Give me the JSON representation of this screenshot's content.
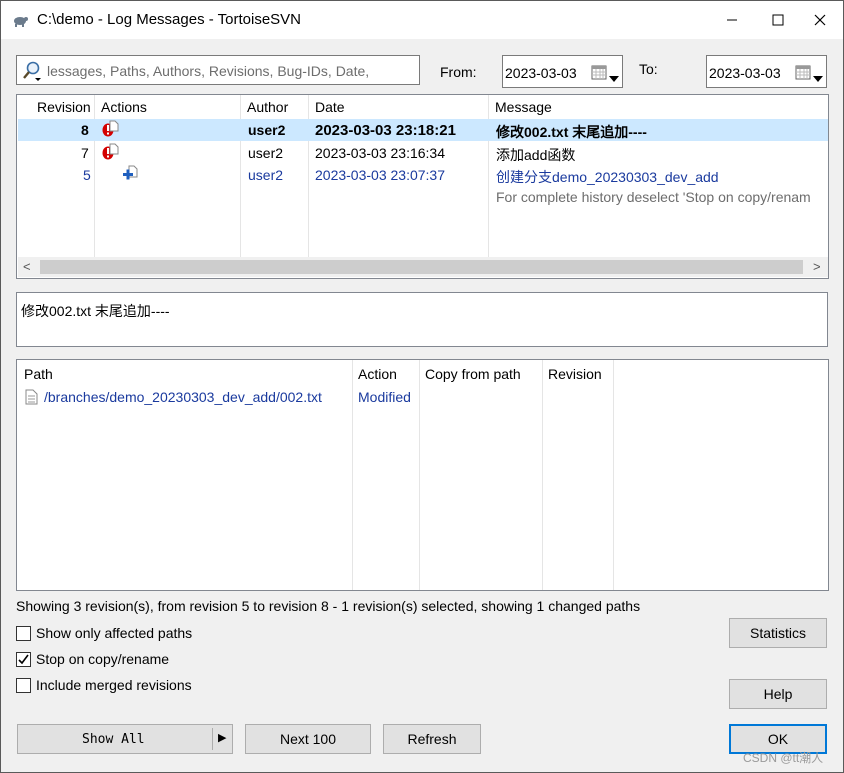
{
  "window": {
    "title": "C:\\demo - Log Messages - TortoiseSVN",
    "controls": {
      "minimize": "minimize",
      "maximize": "maximize",
      "close": "close"
    }
  },
  "filter": {
    "search_text": "lessages, Paths, Authors, Revisions, Bug-IDs, Date,",
    "from_label": "From:",
    "from_value": "2023-03-03",
    "to_label": "To:",
    "to_value": "2023-03-03"
  },
  "revisions": {
    "columns": [
      "Revision",
      "Actions",
      "Author",
      "Date",
      "Message"
    ],
    "rows": [
      {
        "revision": "8",
        "author": "user2",
        "date": "2023-03-03 23:18:21",
        "message": "修改002.txt 末尾追加----",
        "style": "selected-bold",
        "action_icons": [
          "error-icon",
          "file-icon"
        ]
      },
      {
        "revision": "7",
        "author": "user2",
        "date": "2023-03-03 23:16:34",
        "message": "添加add函数",
        "style": "normal",
        "action_icons": [
          "error-icon",
          "file-icon"
        ]
      },
      {
        "revision": "5",
        "author": "user2",
        "date": "2023-03-03 23:07:37",
        "message": "创建分支demo_20230303_dev_add",
        "style": "copy",
        "action_icons": [
          "add-copy-icon"
        ]
      }
    ],
    "note": "For complete history deselect 'Stop on copy/renam",
    "scroll_left": "<",
    "scroll_right": ">"
  },
  "message_box": {
    "text": "修改002.txt 末尾追加----"
  },
  "changed_paths": {
    "columns": [
      "Path",
      "Action",
      "Copy from path",
      "Revision"
    ],
    "rows": [
      {
        "path": "/branches/demo_20230303_dev_add/002.txt",
        "action": "Modified",
        "copy_from": "",
        "revision": ""
      }
    ]
  },
  "status_text": "Showing 3 revision(s), from revision 5 to revision 8 - 1 revision(s) selected, showing 1 changed paths",
  "options": [
    {
      "label": "Show only affected paths",
      "checked": false
    },
    {
      "label": "Stop on copy/rename",
      "checked": true
    },
    {
      "label": "Include merged revisions",
      "checked": false
    }
  ],
  "buttons": {
    "statistics": "Statistics",
    "help": "Help",
    "show_all": "Show All",
    "show_all_arrow": "▶",
    "next_100": "Next 100",
    "refresh": "Refresh",
    "ok": "OK"
  },
  "watermark": "CSDN @tt潮人",
  "colors": {
    "selection": "#cce8ff",
    "copy_blue": "#1a3a9e",
    "error_red": "#d40000",
    "ok_border": "#0078d7",
    "note_gray": "#6d6d6d"
  }
}
